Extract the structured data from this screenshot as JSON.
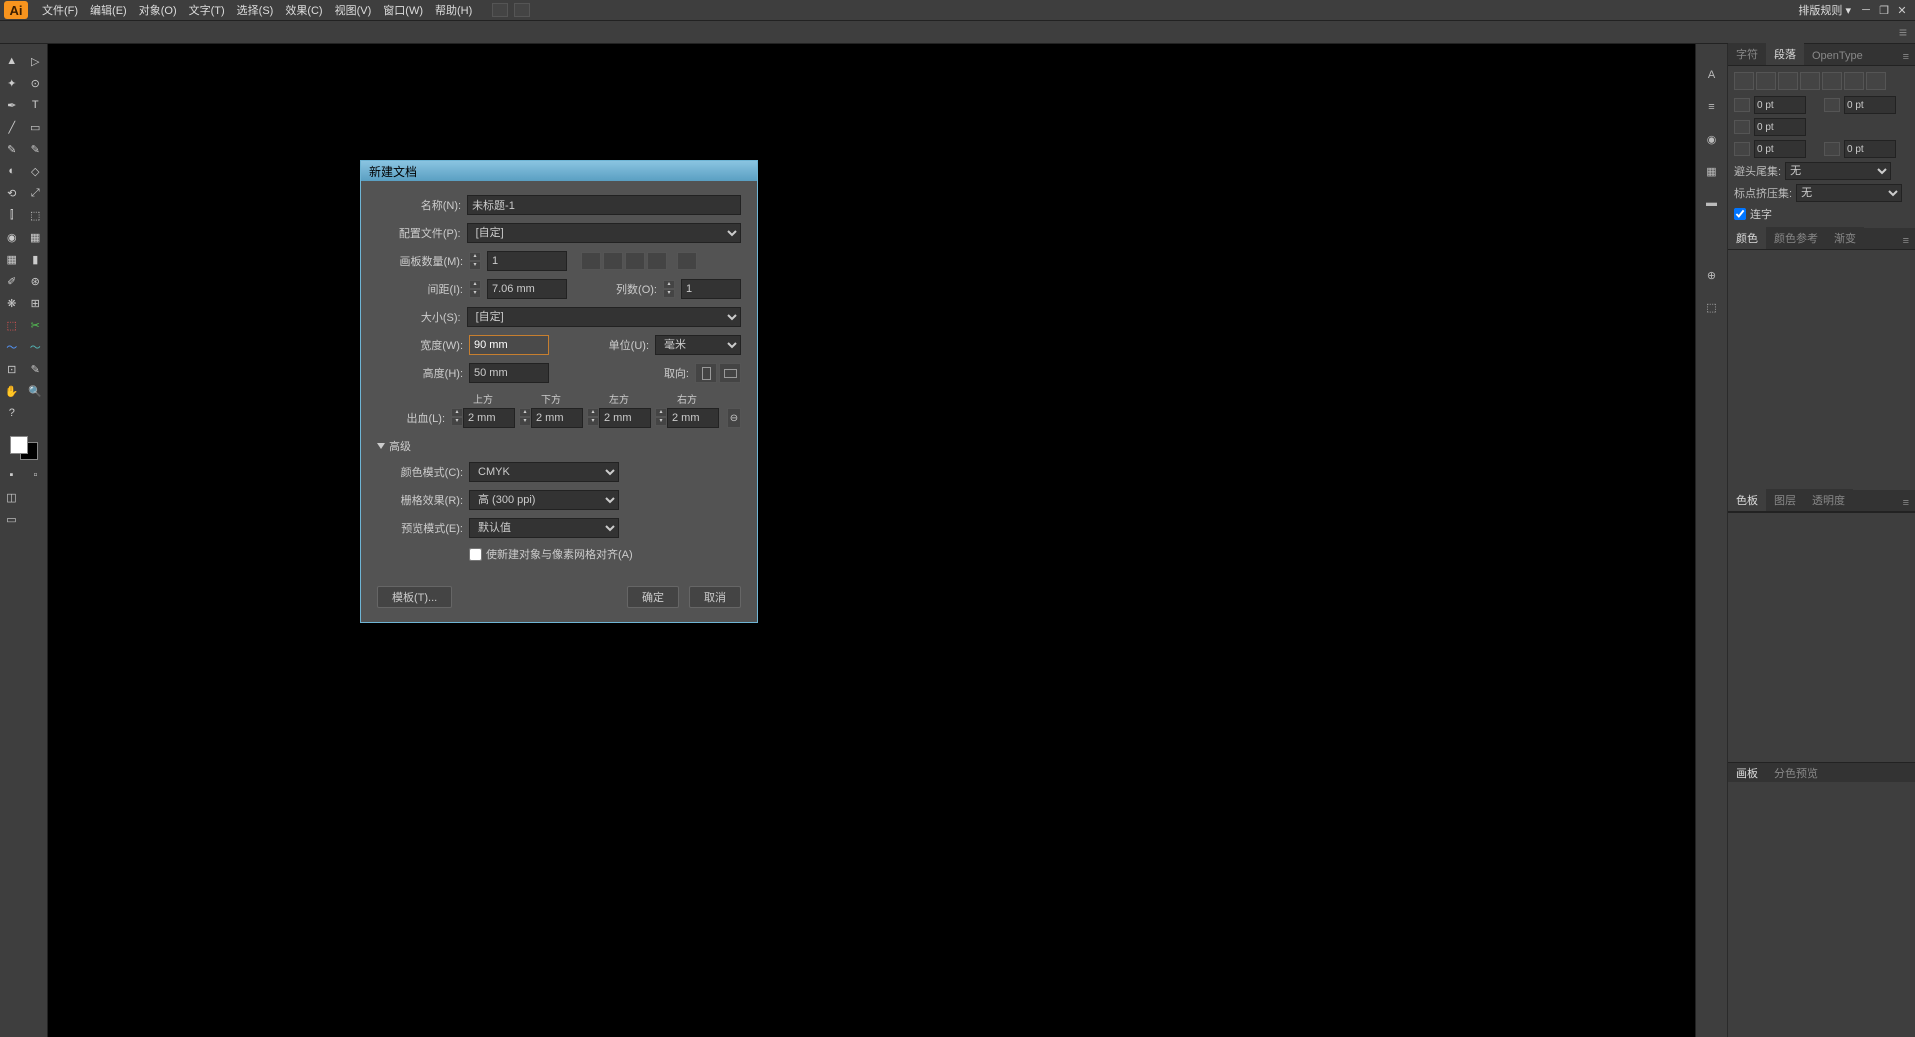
{
  "menubar": {
    "logo": "Ai",
    "items": [
      "文件(F)",
      "编辑(E)",
      "对象(O)",
      "文字(T)",
      "选择(S)",
      "效果(C)",
      "视图(V)",
      "窗口(W)",
      "帮助(H)"
    ],
    "right": "排版规则"
  },
  "paragraph_panel": {
    "tabs": [
      "字符",
      "段落",
      "OpenType"
    ],
    "val1": "0 pt",
    "val2": "0 pt",
    "val3": "0 pt",
    "val4": "0 pt",
    "val5": "0 pt",
    "hyphen_label": "避头尾集:",
    "hyphen_value": "无",
    "punct_label": "标点挤压集:",
    "punct_value": "无",
    "hyphenate": "连字"
  },
  "color_panel": {
    "tabs": [
      "颜色",
      "颜色参考",
      "渐变"
    ]
  },
  "swatch_panel": {
    "tabs": [
      "色板",
      "图层",
      "透明度"
    ],
    "footer": [
      "画板",
      "分色预览"
    ]
  },
  "dialog": {
    "title": "新建文档",
    "name_label": "名称(N):",
    "name_value": "未标题-1",
    "profile_label": "配置文件(P):",
    "profile_value": "[自定]",
    "artboards_label": "画板数量(M):",
    "artboards_value": "1",
    "spacing_label": "间距(I):",
    "spacing_value": "7.06 mm",
    "columns_label": "列数(O):",
    "columns_value": "1",
    "size_label": "大小(S):",
    "size_value": "[自定]",
    "width_label": "宽度(W):",
    "width_value": "90 mm",
    "units_label": "单位(U):",
    "units_value": "毫米",
    "height_label": "高度(H):",
    "height_value": "50 mm",
    "orient_label": "取向:",
    "bleed_label": "出血(L):",
    "bleed_top": "上方",
    "bleed_bottom": "下方",
    "bleed_left": "左方",
    "bleed_right": "右方",
    "bleed_val": "2 mm",
    "advanced": "高级",
    "colormode_label": "颜色模式(C):",
    "colormode_value": "CMYK",
    "raster_label": "栅格效果(R):",
    "raster_value": "高 (300 ppi)",
    "preview_label": "预览模式(E):",
    "preview_value": "默认值",
    "align_pixel": "使新建对象与像素网格对齐(A)",
    "templates_btn": "模板(T)...",
    "ok_btn": "确定",
    "cancel_btn": "取消"
  }
}
